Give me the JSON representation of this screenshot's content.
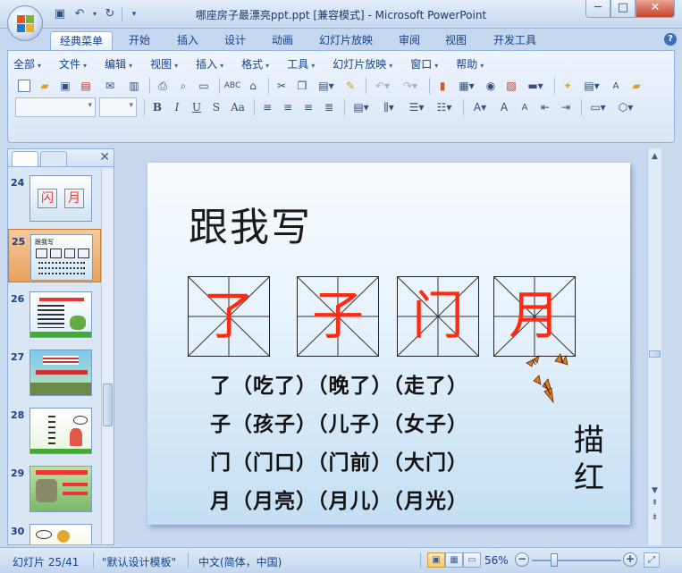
{
  "window": {
    "title": "哪座房子最漂亮ppt.ppt [兼容模式] - Microsoft PowerPoint",
    "min_glyph": "─",
    "max_glyph": "□",
    "close_glyph": "✕"
  },
  "ribbon_tabs": [
    {
      "label": "经典菜单"
    },
    {
      "label": "开始"
    },
    {
      "label": "插入"
    },
    {
      "label": "设计"
    },
    {
      "label": "动画"
    },
    {
      "label": "幻灯片放映"
    },
    {
      "label": "审阅"
    },
    {
      "label": "视图"
    },
    {
      "label": "开发工具"
    }
  ],
  "menus": [
    {
      "label": "全部"
    },
    {
      "label": "文件"
    },
    {
      "label": "编辑"
    },
    {
      "label": "视图"
    },
    {
      "label": "插入"
    },
    {
      "label": "格式"
    },
    {
      "label": "工具"
    },
    {
      "label": "幻灯片放映"
    },
    {
      "label": "窗口"
    },
    {
      "label": "帮助"
    }
  ],
  "format_buttons": {
    "bold": "B",
    "italic": "I",
    "underline": "U",
    "shadow": "S",
    "case": "Aa"
  },
  "thumbnails": [
    {
      "num": "24"
    },
    {
      "num": "25"
    },
    {
      "num": "26"
    },
    {
      "num": "27"
    },
    {
      "num": "28"
    },
    {
      "num": "29"
    },
    {
      "num": "30"
    }
  ],
  "thumb24": {
    "chars": [
      "闪",
      "月"
    ]
  },
  "thumb25": {
    "title": "跟我写"
  },
  "slide": {
    "title": "跟我写",
    "grid_chars": [
      "了",
      "子",
      "门",
      "月"
    ],
    "phrases": [
      "了（吃了）（晚了）（走了）",
      "子（孩子）（儿子）（女子）",
      "门（门口）（门前）（大门）",
      "月（月亮）（月儿）（月光）"
    ],
    "side_text": [
      "描",
      "红"
    ]
  },
  "status": {
    "slide_info": "幻灯片 25/41",
    "template": "\"默认设计模板\"",
    "language": "中文(简体，中国)",
    "zoom": "56%"
  },
  "colors": {
    "grid_char": "#ff2a12",
    "selected_thumb": "#e8a15e",
    "accent": "#15428b"
  }
}
